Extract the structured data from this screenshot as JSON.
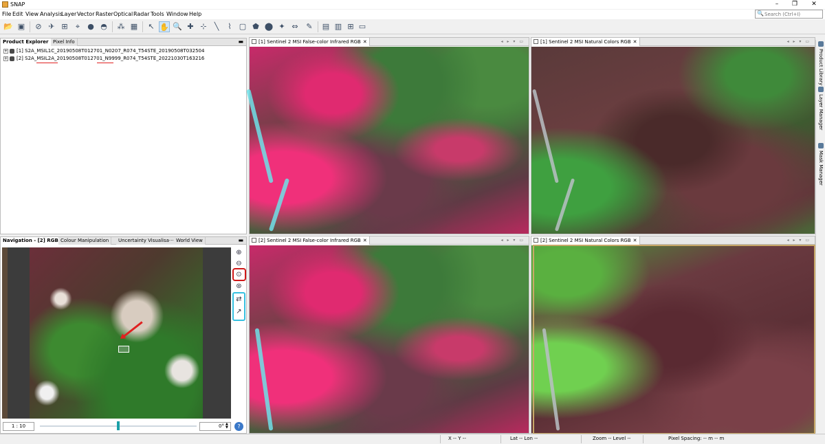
{
  "window": {
    "title": "SNAP",
    "minimize": "–",
    "restore": "❐",
    "close": "✕"
  },
  "menu": [
    "File",
    "Edit",
    "View",
    "Analysis",
    "Layer",
    "Vector",
    "Raster",
    "Optical",
    "Radar",
    "Tools",
    "Window",
    "Help"
  ],
  "search": {
    "placeholder": "Search (Ctrl+I)"
  },
  "product_panel": {
    "tabs": [
      "Product Explorer",
      "Pixel Info"
    ],
    "products": [
      {
        "label": "[1] S2A_MSIL1C_20190508T012701_N0207_R074_T54STE_20190508T032504"
      },
      {
        "label": "[2] S2A_MSIL2A_20190508T012701_N9999_R074_T54STE_20221030T163216"
      }
    ]
  },
  "nav_panel": {
    "tabs": [
      "Navigation - [2] RGB",
      "Colour Manipulation",
      "Uncertainty Visualisa···",
      "World View"
    ],
    "scale": "1 : 10",
    "angle": "0°",
    "slider_fraction": 0.5
  },
  "image_windows": [
    {
      "title": "[1] Sentinel 2 MSI False-color Infrared RGB"
    },
    {
      "title": "[1] Sentinel 2 MSI Natural Colors RGB"
    },
    {
      "title": "[2] Sentinel 2 MSI False-color Infrared RGB"
    },
    {
      "title": "[2] Sentinel 2 MSI Natural Colors RGB"
    }
  ],
  "right_sidebar": [
    "Product Library",
    "Layer Manager",
    "Mask Manager"
  ],
  "status": {
    "x": "X  -- Y  --",
    "lat": "Lat  --  Lon  --",
    "zoom": "Zoom -- Level --",
    "pixel": "Pixel Spacing: -- m -- m"
  },
  "colors": {
    "highlight_red": "#d01818",
    "highlight_cyan": "#36c0e0",
    "selected_window_border": "#c8a868"
  }
}
